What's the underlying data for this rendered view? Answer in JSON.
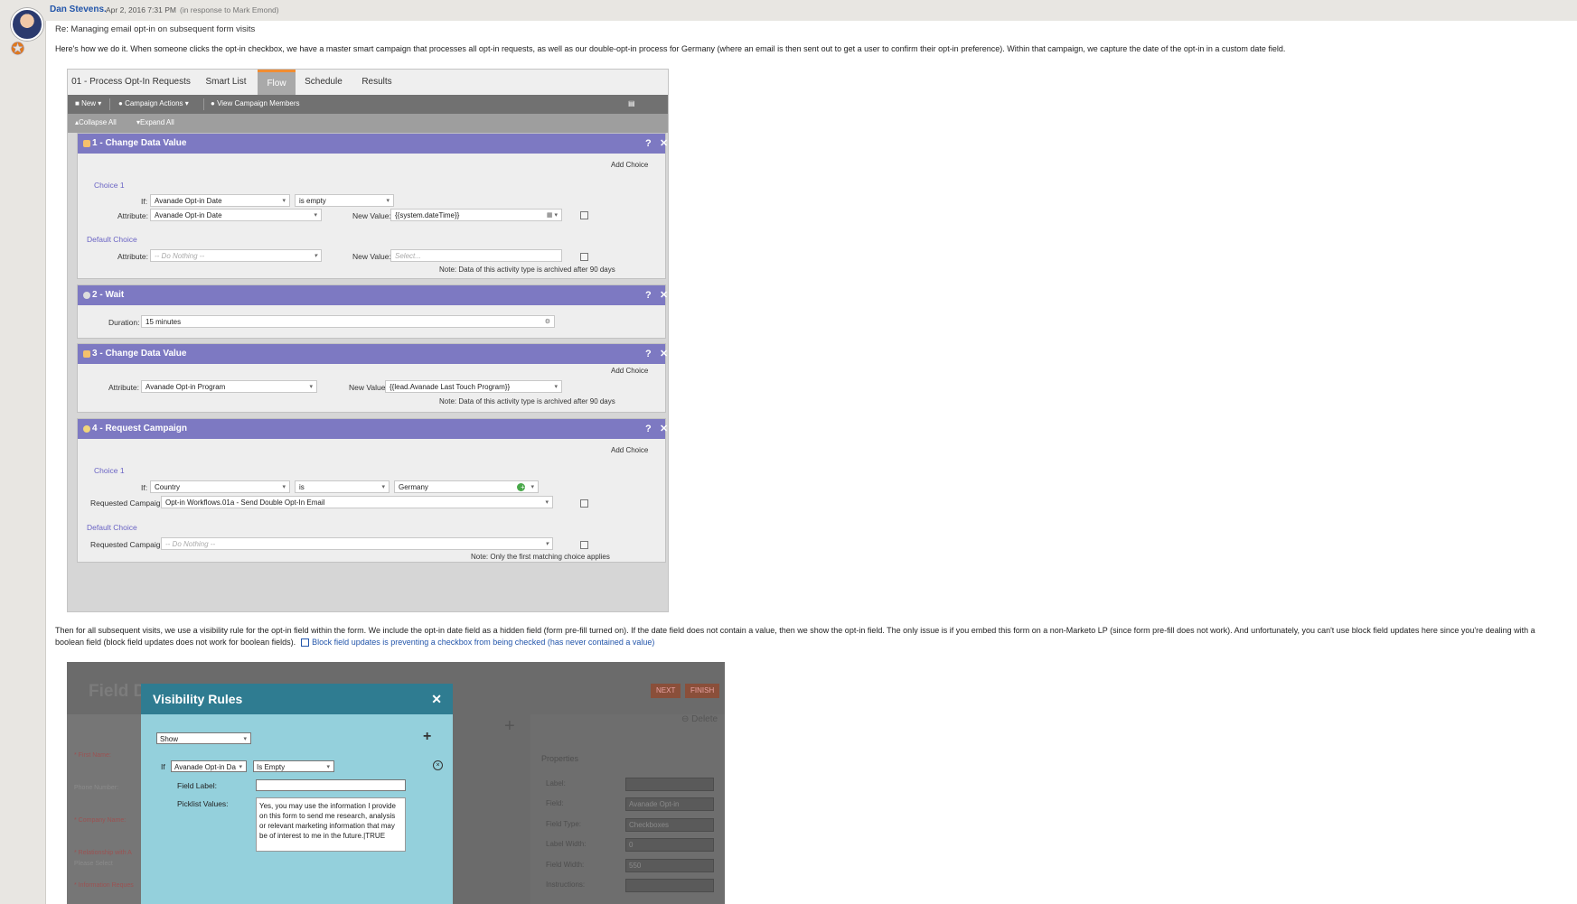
{
  "post": {
    "author": "Dan Stevens.",
    "date": "Apr 2, 2016 7:31 PM",
    "in_response": "(in response to Mark Emond)",
    "subject": "Re: Managing email opt-in on subsequent form visits",
    "paragraph1": "Here's how we do it.  When someone clicks the opt-in checkbox, we have a master smart campaign that processes all opt-in requests, as well as our double-opt-in process for Germany (where an email is then sent out to get a user to confirm their opt-in preference).  Within that campaign, we capture the date of the opt-in in a custom date field.",
    "paragraph2": "Then for all subsequent visits, we use a visibility rule for the opt-in field within the form.  We include the opt-in date field as a hidden field (form pre-fill turned on).  If the date field does not contain a value, then we show the opt-in field.  The only issue is if you embed this form on a non-Marketo LP (since form pre-fill does not work).  And unfortunately, you can't use block field updates here since you're dealing with a boolean field (block field updates does not work for boolean fields).",
    "link_text": "Block field updates is preventing a checkbox from being checked (has never contained a value)"
  },
  "flow": {
    "tabs": [
      "01 - Process Opt-In Requests",
      "Smart List",
      "Flow",
      "Schedule",
      "Results"
    ],
    "toolbar": {
      "new": "New",
      "campaign_actions": "Campaign Actions",
      "view_members": "View Campaign Members"
    },
    "subbar": {
      "collapse": "Collapse All",
      "expand": "Expand All"
    },
    "step1": {
      "title": "1 - Change Data Value",
      "add_choice": "Add Choice",
      "choice": "Choice 1",
      "if_label": "If:",
      "if_field": "Avanade Opt-in Date",
      "if_op": "is empty",
      "attr_label": "Attribute:",
      "attr_value": "Avanade Opt-in Date",
      "newval_label": "New Value:",
      "newval_value": "{{system.dateTime}}",
      "default_choice": "Default Choice",
      "def_attr_value": "-- Do Nothing --",
      "def_newval_value": "Select...",
      "note": "Note: Data of this activity type is archived after 90 days"
    },
    "step2": {
      "title": "2 - Wait",
      "duration_label": "Duration:",
      "duration_value": "15 minutes"
    },
    "step3": {
      "title": "3 - Change Data Value",
      "add_choice": "Add Choice",
      "attr_label": "Attribute:",
      "attr_value": "Avanade Opt-in Program",
      "newval_label": "New Value:",
      "newval_value": "{{lead.Avanade Last Touch Program}}",
      "note": "Note: Data of this activity type is archived after 90 days"
    },
    "step4": {
      "title": "4 - Request Campaign",
      "add_choice": "Add Choice",
      "choice": "Choice 1",
      "if_label": "If:",
      "if_field": "Country",
      "if_op": "is",
      "if_value": "Germany",
      "req_label": "Requested Campaign:",
      "req_value": "Opt-in Workflows.01a - Send Double Opt-In Email",
      "default_choice": "Default Choice",
      "def_req_value": "-- Do Nothing --",
      "note": "Note: Only the first matching choice applies"
    }
  },
  "form_editor": {
    "bg_title": "Field D",
    "next": "NEXT",
    "finish": "FINISH",
    "delete": "Delete",
    "left_labels": [
      "* First Name:",
      "Phone Number:",
      "* Company Name:",
      "* Relationship with A",
      "Please Select",
      "* Information Reques"
    ],
    "properties_title": "Properties",
    "prop_labels": [
      "Label:",
      "Field:",
      "Field Type:",
      "Label Width:",
      "Field Width:",
      "Instructions:"
    ],
    "prop_values": [
      "",
      "Avanade Opt-in",
      "Checkboxes",
      "0",
      "550",
      ""
    ],
    "dialog": {
      "title": "Visibility Rules",
      "close": "✕",
      "show_select": "Show",
      "if_label": "If",
      "if_field": "Avanade Opt-in Da",
      "if_op": "Is Empty",
      "field_label": "Field Label:",
      "picklist_label": "Picklist Values:",
      "picklist_value": "Yes, you may use the information I provide on this form to send me research, analysis or relevant marketing information that may be of interest to me in the future.|TRUE"
    }
  }
}
